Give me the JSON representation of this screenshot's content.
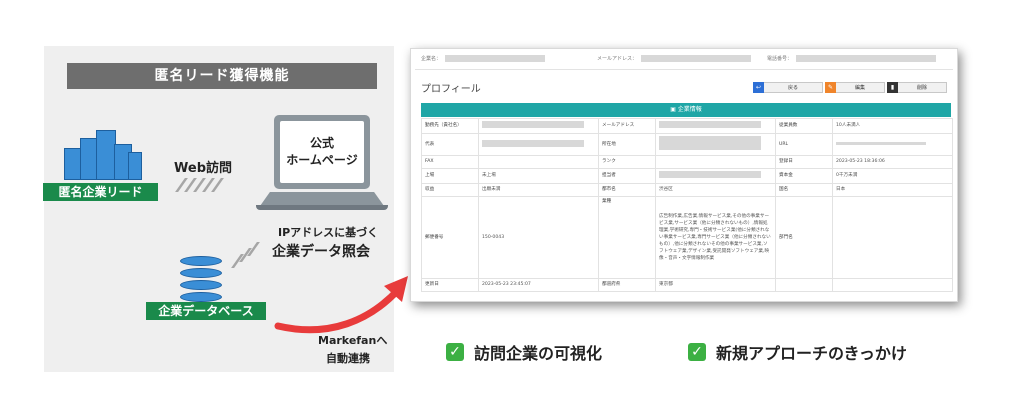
{
  "title": "匿名リード獲得機能",
  "left": {
    "anon_lead_label": "匿名企業リード",
    "web_visit": "Web訪問",
    "homepage_line1": "公式",
    "homepage_line2": "ホームページ",
    "ip_line1": "IPアドレスに基づく",
    "ip_line2": "企業データ照会",
    "db_label": "企業データベース",
    "markefan_line1": "Markefanへ",
    "markefan_line2": "自動連携"
  },
  "card": {
    "top_fields": [
      "企業名：",
      "メールアドレス：",
      "電話番号："
    ],
    "profile_title": "プロフィール",
    "buttons": [
      {
        "label": "戻る",
        "icon": "back-icon",
        "color": "#2d6fd6"
      },
      {
        "label": "編集",
        "icon": "edit-icon",
        "color": "#f0852b"
      },
      {
        "label": "削除",
        "icon": "trash-icon",
        "color": "#333333"
      }
    ],
    "section_title": "企業情報",
    "rows": [
      [
        "勤務先（貴社名）",
        "",
        "メールアドレス",
        "",
        "従業員数",
        "10人未満人"
      ],
      [
        "代表",
        "",
        "所在地",
        "",
        "URL",
        ""
      ],
      [
        "FAX",
        "",
        "ランク",
        "",
        "登録日",
        "2023-05-23 18:36:06"
      ],
      [
        "上場",
        "未上場",
        "担当者",
        "",
        "資本金",
        "0千万未満"
      ],
      [
        "収益",
        "出願未満",
        "都市名",
        "渋谷区",
        "国名",
        "日本"
      ],
      [
        "郵便番号",
        "150-0043",
        "業種",
        "広告制作業,広告業,情報サービス業,その他の事業サービス業,サービス業（他に分類されないもの）,情報処理業,学術研究,専門・技術サービス業(他に分類されない事業サービス業,専門サービス業（他に分類されないもの）,他に分類されないその他の事業サービス業,ソフトウェア業,デザイン業,受託開発ソフトウェア業,映像・音声・文字情報制作業",
        "部門名",
        ""
      ],
      [
        "更新日",
        "2023-05-23 23:45:07",
        "都道府県",
        "東京都",
        "",
        ""
      ]
    ]
  },
  "checks": [
    "訪問企業の可視化",
    "新規アプローチのきっかけ"
  ],
  "colors": {
    "green": "#1a8a4b",
    "teal": "#1fa6a6",
    "arrow": "#e83b3b",
    "check": "#3cb043"
  }
}
